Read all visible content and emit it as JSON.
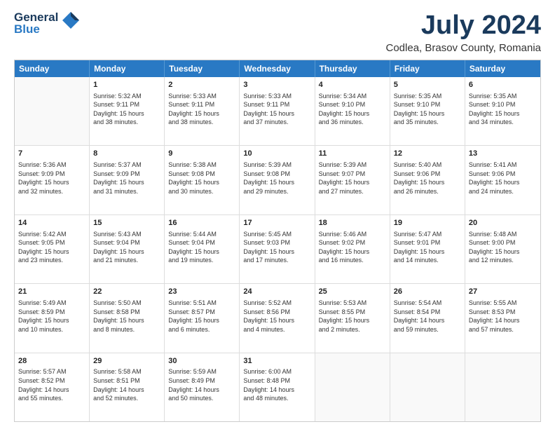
{
  "logo": {
    "general": "General",
    "blue": "Blue"
  },
  "title": {
    "month": "July 2024",
    "location": "Codlea, Brasov County, Romania"
  },
  "calendar": {
    "headers": [
      "Sunday",
      "Monday",
      "Tuesday",
      "Wednesday",
      "Thursday",
      "Friday",
      "Saturday"
    ],
    "rows": [
      [
        {
          "day": "",
          "info": ""
        },
        {
          "day": "1",
          "info": "Sunrise: 5:32 AM\nSunset: 9:11 PM\nDaylight: 15 hours\nand 38 minutes."
        },
        {
          "day": "2",
          "info": "Sunrise: 5:33 AM\nSunset: 9:11 PM\nDaylight: 15 hours\nand 38 minutes."
        },
        {
          "day": "3",
          "info": "Sunrise: 5:33 AM\nSunset: 9:11 PM\nDaylight: 15 hours\nand 37 minutes."
        },
        {
          "day": "4",
          "info": "Sunrise: 5:34 AM\nSunset: 9:10 PM\nDaylight: 15 hours\nand 36 minutes."
        },
        {
          "day": "5",
          "info": "Sunrise: 5:35 AM\nSunset: 9:10 PM\nDaylight: 15 hours\nand 35 minutes."
        },
        {
          "day": "6",
          "info": "Sunrise: 5:35 AM\nSunset: 9:10 PM\nDaylight: 15 hours\nand 34 minutes."
        }
      ],
      [
        {
          "day": "7",
          "info": "Sunrise: 5:36 AM\nSunset: 9:09 PM\nDaylight: 15 hours\nand 32 minutes."
        },
        {
          "day": "8",
          "info": "Sunrise: 5:37 AM\nSunset: 9:09 PM\nDaylight: 15 hours\nand 31 minutes."
        },
        {
          "day": "9",
          "info": "Sunrise: 5:38 AM\nSunset: 9:08 PM\nDaylight: 15 hours\nand 30 minutes."
        },
        {
          "day": "10",
          "info": "Sunrise: 5:39 AM\nSunset: 9:08 PM\nDaylight: 15 hours\nand 29 minutes."
        },
        {
          "day": "11",
          "info": "Sunrise: 5:39 AM\nSunset: 9:07 PM\nDaylight: 15 hours\nand 27 minutes."
        },
        {
          "day": "12",
          "info": "Sunrise: 5:40 AM\nSunset: 9:06 PM\nDaylight: 15 hours\nand 26 minutes."
        },
        {
          "day": "13",
          "info": "Sunrise: 5:41 AM\nSunset: 9:06 PM\nDaylight: 15 hours\nand 24 minutes."
        }
      ],
      [
        {
          "day": "14",
          "info": "Sunrise: 5:42 AM\nSunset: 9:05 PM\nDaylight: 15 hours\nand 23 minutes."
        },
        {
          "day": "15",
          "info": "Sunrise: 5:43 AM\nSunset: 9:04 PM\nDaylight: 15 hours\nand 21 minutes."
        },
        {
          "day": "16",
          "info": "Sunrise: 5:44 AM\nSunset: 9:04 PM\nDaylight: 15 hours\nand 19 minutes."
        },
        {
          "day": "17",
          "info": "Sunrise: 5:45 AM\nSunset: 9:03 PM\nDaylight: 15 hours\nand 17 minutes."
        },
        {
          "day": "18",
          "info": "Sunrise: 5:46 AM\nSunset: 9:02 PM\nDaylight: 15 hours\nand 16 minutes."
        },
        {
          "day": "19",
          "info": "Sunrise: 5:47 AM\nSunset: 9:01 PM\nDaylight: 15 hours\nand 14 minutes."
        },
        {
          "day": "20",
          "info": "Sunrise: 5:48 AM\nSunset: 9:00 PM\nDaylight: 15 hours\nand 12 minutes."
        }
      ],
      [
        {
          "day": "21",
          "info": "Sunrise: 5:49 AM\nSunset: 8:59 PM\nDaylight: 15 hours\nand 10 minutes."
        },
        {
          "day": "22",
          "info": "Sunrise: 5:50 AM\nSunset: 8:58 PM\nDaylight: 15 hours\nand 8 minutes."
        },
        {
          "day": "23",
          "info": "Sunrise: 5:51 AM\nSunset: 8:57 PM\nDaylight: 15 hours\nand 6 minutes."
        },
        {
          "day": "24",
          "info": "Sunrise: 5:52 AM\nSunset: 8:56 PM\nDaylight: 15 hours\nand 4 minutes."
        },
        {
          "day": "25",
          "info": "Sunrise: 5:53 AM\nSunset: 8:55 PM\nDaylight: 15 hours\nand 2 minutes."
        },
        {
          "day": "26",
          "info": "Sunrise: 5:54 AM\nSunset: 8:54 PM\nDaylight: 14 hours\nand 59 minutes."
        },
        {
          "day": "27",
          "info": "Sunrise: 5:55 AM\nSunset: 8:53 PM\nDaylight: 14 hours\nand 57 minutes."
        }
      ],
      [
        {
          "day": "28",
          "info": "Sunrise: 5:57 AM\nSunset: 8:52 PM\nDaylight: 14 hours\nand 55 minutes."
        },
        {
          "day": "29",
          "info": "Sunrise: 5:58 AM\nSunset: 8:51 PM\nDaylight: 14 hours\nand 52 minutes."
        },
        {
          "day": "30",
          "info": "Sunrise: 5:59 AM\nSunset: 8:49 PM\nDaylight: 14 hours\nand 50 minutes."
        },
        {
          "day": "31",
          "info": "Sunrise: 6:00 AM\nSunset: 8:48 PM\nDaylight: 14 hours\nand 48 minutes."
        },
        {
          "day": "",
          "info": ""
        },
        {
          "day": "",
          "info": ""
        },
        {
          "day": "",
          "info": ""
        }
      ]
    ]
  }
}
